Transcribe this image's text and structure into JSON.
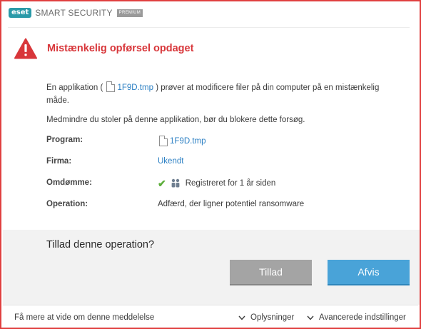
{
  "app": {
    "logo_text": "eset",
    "product": "SMART SECURITY",
    "edition": "PREMIUM"
  },
  "alert": {
    "title": "Mistænkelig opførsel opdaget",
    "desc_before": "En applikation (",
    "desc_file": "1F9D.tmp",
    "desc_after": ") prøver at modificere filer på din computer på en mistænkelig måde.",
    "advice": "Medmindre du stoler på denne applikation, bør du blokere dette forsøg."
  },
  "details": {
    "program_label": "Program:",
    "program_value": "1F9D.tmp",
    "company_label": "Firma:",
    "company_value": "Ukendt",
    "reputation_label": "Omdømme:",
    "reputation_value": "Registreret for 1 år siden",
    "operation_label": "Operation:",
    "operation_value": "Adfærd, der ligner potentiel ransomware"
  },
  "prompt": {
    "question": "Tillad denne operation?",
    "allow_label": "Tillad",
    "deny_label": "Afvis"
  },
  "footer": {
    "learn_more": "Få mere at vide om denne meddelelse",
    "details_toggle": "Oplysninger",
    "advanced_toggle": "Avancerede indstillinger"
  },
  "colors": {
    "border": "#e04040",
    "alert_title": "#d8363a",
    "link": "#2b7fc3",
    "allow_button": "#a4a4a4",
    "deny_button": "#49a3d8",
    "logo": "#2a9aa8"
  },
  "icons": {
    "warning": "warning-triangle-icon",
    "file": "file-icon",
    "check": "check-icon",
    "users": "people-icon",
    "chevron": "chevron-down-icon"
  }
}
